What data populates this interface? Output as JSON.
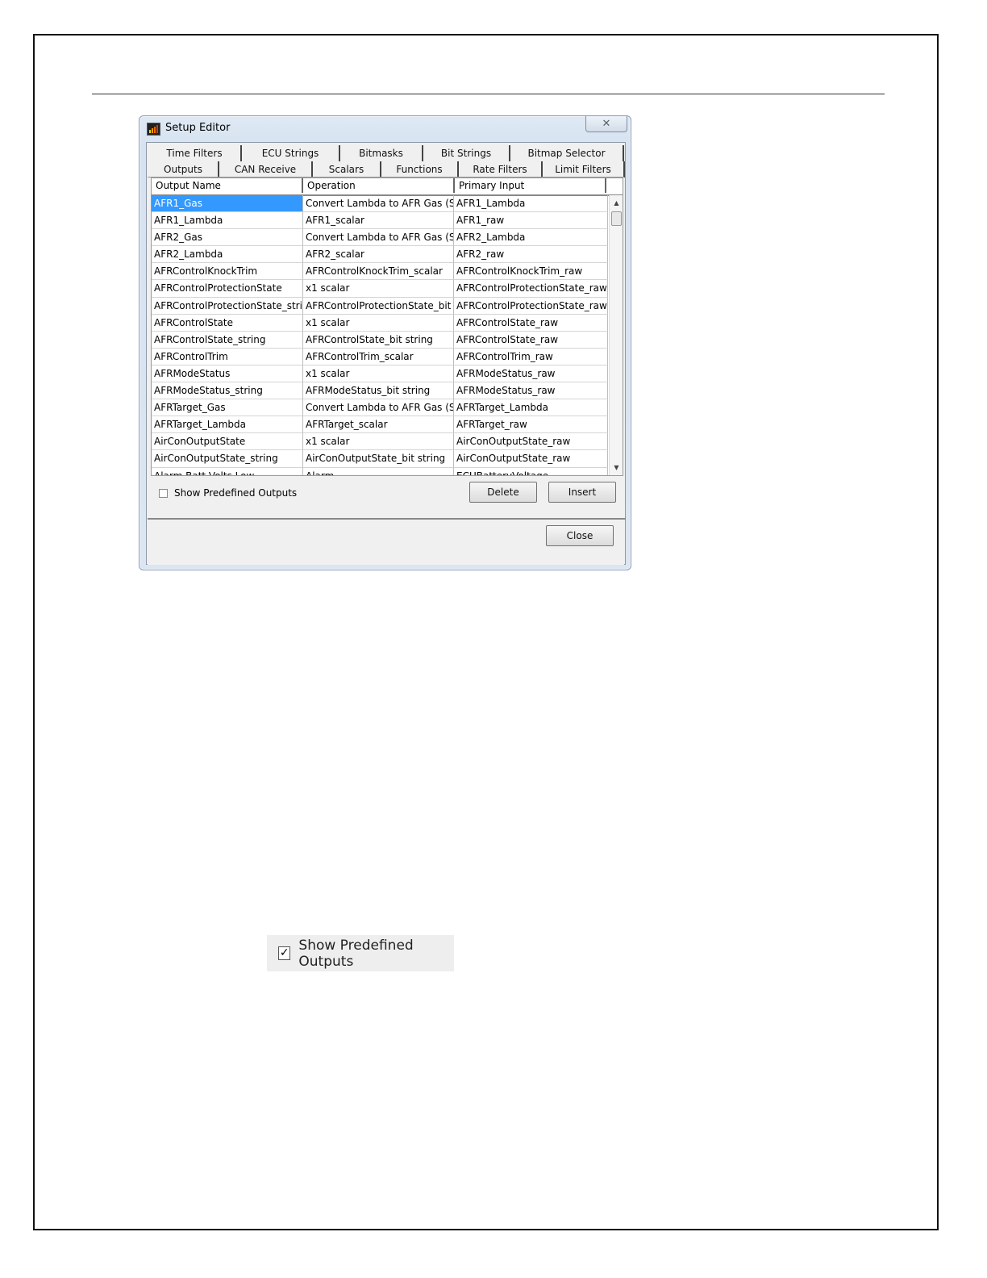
{
  "dialog": {
    "title": "Setup Editor",
    "close_glyph": "✕",
    "tabs_row1": [
      "Time Filters",
      "ECU Strings",
      "Bitmasks",
      "Bit Strings",
      "Bitmap Selector"
    ],
    "tabs_row2": [
      "Outputs",
      "CAN Receive",
      "Scalars",
      "Functions",
      "Rate Filters",
      "Limit Filters"
    ],
    "active_tab": "Outputs",
    "columns": [
      "Output Name",
      "Operation",
      "Primary Input"
    ],
    "rows": [
      [
        "AFR1_Gas",
        "Convert Lambda to AFR Gas (Stoic",
        "AFR1_Lambda"
      ],
      [
        "AFR1_Lambda",
        "AFR1_scalar",
        "AFR1_raw"
      ],
      [
        "AFR2_Gas",
        "Convert Lambda to AFR Gas (Stoic",
        "AFR2_Lambda"
      ],
      [
        "AFR2_Lambda",
        "AFR2_scalar",
        "AFR2_raw"
      ],
      [
        "AFRControlKnockTrim",
        "AFRControlKnockTrim_scalar",
        "AFRControlKnockTrim_raw"
      ],
      [
        "AFRControlProtectionState",
        "x1 scalar",
        "AFRControlProtectionState_raw"
      ],
      [
        "AFRControlProtectionState_string",
        "AFRControlProtectionState_bit strir",
        "AFRControlProtectionState_raw"
      ],
      [
        "AFRControlState",
        "x1 scalar",
        "AFRControlState_raw"
      ],
      [
        "AFRControlState_string",
        "AFRControlState_bit string",
        "AFRControlState_raw"
      ],
      [
        "AFRControlTrim",
        "AFRControlTrim_scalar",
        "AFRControlTrim_raw"
      ],
      [
        "AFRModeStatus",
        "x1 scalar",
        "AFRModeStatus_raw"
      ],
      [
        "AFRModeStatus_string",
        "AFRModeStatus_bit string",
        "AFRModeStatus_raw"
      ],
      [
        "AFRTarget_Gas",
        "Convert Lambda to AFR Gas (Stoic",
        "AFRTarget_Lambda"
      ],
      [
        "AFRTarget_Lambda",
        "AFRTarget_scalar",
        "AFRTarget_raw"
      ],
      [
        "AirConOutputState",
        "x1 scalar",
        "AirConOutputState_raw"
      ],
      [
        "AirConOutputState_string",
        "AirConOutputState_bit string",
        "AirConOutputState_raw"
      ],
      [
        "Alarm Batt Volts Low",
        "Alarm",
        "ECUBatteryVoltage"
      ]
    ],
    "selected_row": 0,
    "show_predefined_label": "Show Predefined Outputs",
    "show_predefined_checked": false,
    "delete_label": "Delete",
    "insert_label": "Insert",
    "close_label": "Close"
  },
  "zoom_checkbox": {
    "label": "Show Predefined Outputs",
    "checked": true,
    "check_glyph": "✓"
  },
  "colors": {
    "selection": "#3399ff",
    "dialog_frame": "#dbe6f2"
  }
}
